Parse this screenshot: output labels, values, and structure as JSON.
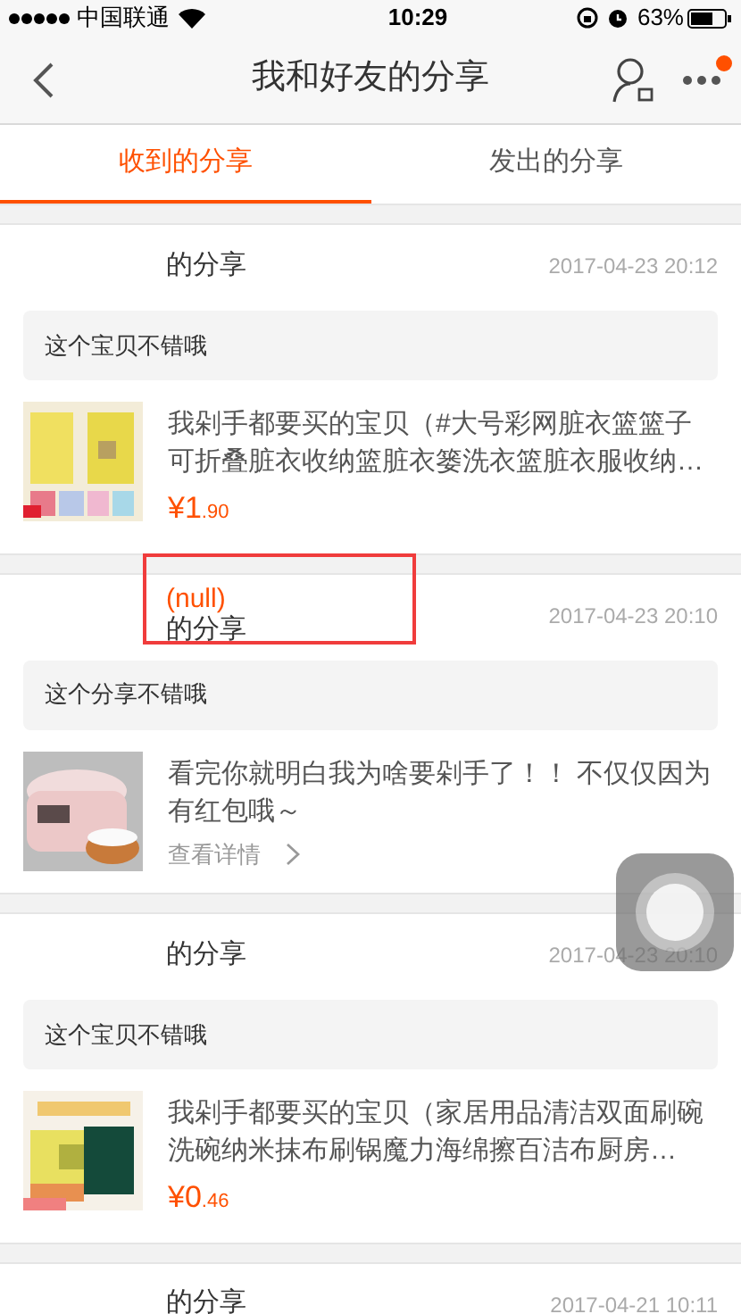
{
  "status_bar": {
    "carrier": "中国联通",
    "time": "10:29",
    "battery": "63%"
  },
  "nav": {
    "title": "我和好友的分享",
    "more_badge": true
  },
  "tabs": [
    {
      "label": "收到的分享",
      "selected": true
    },
    {
      "label": "发出的分享",
      "selected": false
    }
  ],
  "shares": [
    {
      "suffix": "的分享",
      "time": "2017-04-23 20:12",
      "comment": "这个宝贝不错哦",
      "kind": "product",
      "text": "我剁手都要买的宝贝（#大号彩网脏衣篮篮子可折叠脏衣收纳篮脏衣篓洗衣篮脏衣服收纳…",
      "price_main": "¥1",
      "price_decimal": ".90"
    },
    {
      "sender": "(null)",
      "highlighted": true,
      "suffix": "的分享",
      "time": "2017-04-23 20:10",
      "comment": "这个分享不错哦",
      "kind": "article",
      "text": "看完你就明白我为啥要剁手了！！ 不仅仅因为有红包哦～",
      "link": "查看详情"
    },
    {
      "suffix": "的分享",
      "time": "2017-04-23 20:10",
      "comment": "这个宝贝不错哦",
      "kind": "product",
      "text": "我剁手都要买的宝贝（家居用品清洁双面刷碗洗碗纳米抹布刷锅魔力海绵擦百洁布厨房…",
      "price_main": "¥0",
      "price_decimal": ".46"
    },
    {
      "suffix": "的分享",
      "time": "2017-04-21 10:11",
      "kind": "header_only"
    }
  ]
}
